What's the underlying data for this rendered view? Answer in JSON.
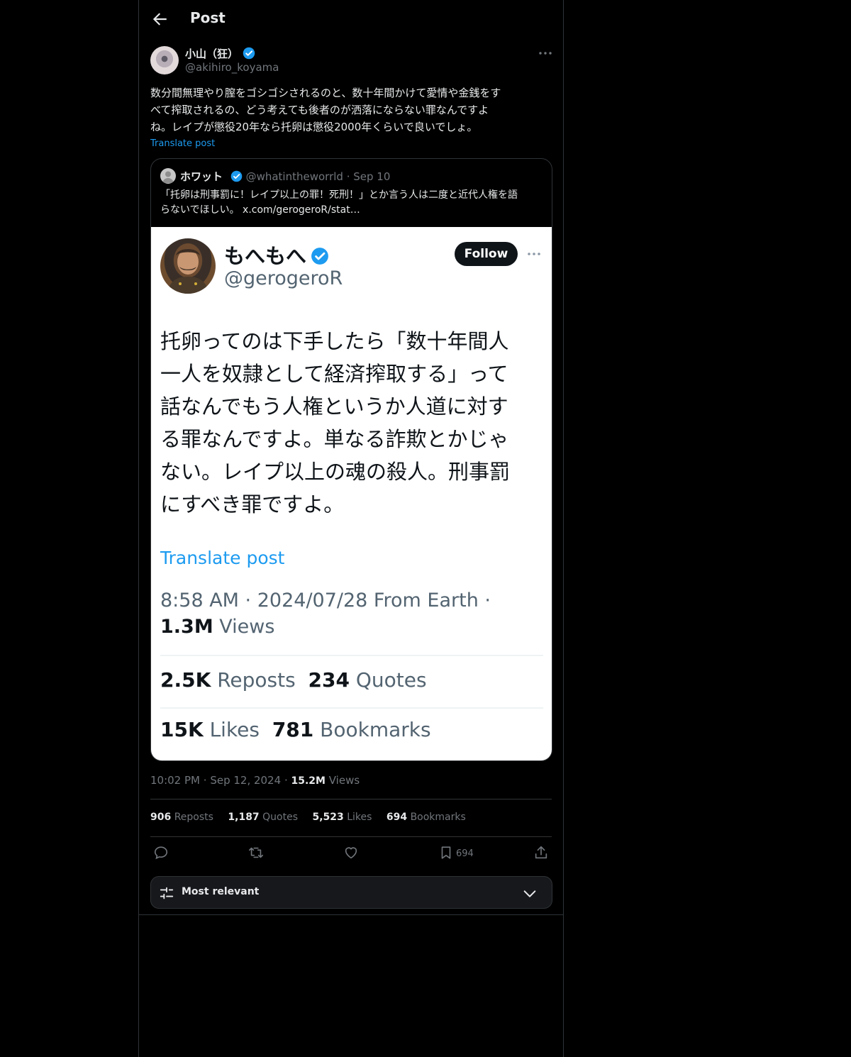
{
  "header": {
    "title": "Post"
  },
  "post": {
    "author_name": "小山（狂）",
    "author_handle": "@akihiro_koyama",
    "text": "数分間無理やり膣をゴシゴシされるのと、数十年間かけて愛情や金銭をす\nべて搾取されるの、どう考えても後者のが洒落にならない罪なんですよ\nね。レイプが懲役20年なら托卵は懲役2000年くらいで良いでしょ。",
    "translate_label": "Translate post",
    "time": "10:02 PM",
    "date": "Sep 12, 2024",
    "views_count": "15.2M",
    "views_label": "Views",
    "stats": {
      "reposts_count": "906",
      "reposts_label": "Reposts",
      "quotes_count": "1,187",
      "quotes_label": "Quotes",
      "likes_count": "5,523",
      "likes_label": "Likes",
      "bookmarks_count": "694",
      "bookmarks_label": "Bookmarks"
    },
    "actions": {
      "bookmark_count": "694"
    }
  },
  "quote": {
    "author_name": "ホワット",
    "author_handle": "@whatintheworrld",
    "date": "Sep 10",
    "text": "「托卵は刑事罰に！レイプ以上の罪！死刑！」とか言う人は二度と近代人権を語\nらないでほしい。 x.com/gerogeroR/stat…",
    "screenshot": {
      "name": "もへもへ",
      "handle": "@gerogeroR",
      "follow_label": "Follow",
      "body": "托卵ってのは下手したら「数十年間人\n一人を奴隷として経済搾取する」って\n話なんでもう人権というか人道に対す\nる罪なんですよ。単なる詐欺とかじゃ\nない。レイプ以上の魂の殺人。刑事罰\nにすべき罪ですよ。",
      "translate_label": "Translate post",
      "meta_time": "8:58 AM · 2024/07/28 From Earth · ",
      "meta_views_count": "1.3M",
      "meta_views_label": "Views",
      "reposts_count": "2.5K",
      "reposts_label": "Reposts",
      "quotes_count": "234",
      "quotes_label": "Quotes",
      "likes_count": "15K",
      "likes_label": "Likes",
      "bookmarks_count": "781",
      "bookmarks_label": "Bookmarks"
    }
  },
  "sort": {
    "label": "Most relevant"
  },
  "colors": {
    "accent": "#1d9bf0",
    "background": "#000000",
    "border": "#2f3336",
    "muted": "#71767b"
  }
}
